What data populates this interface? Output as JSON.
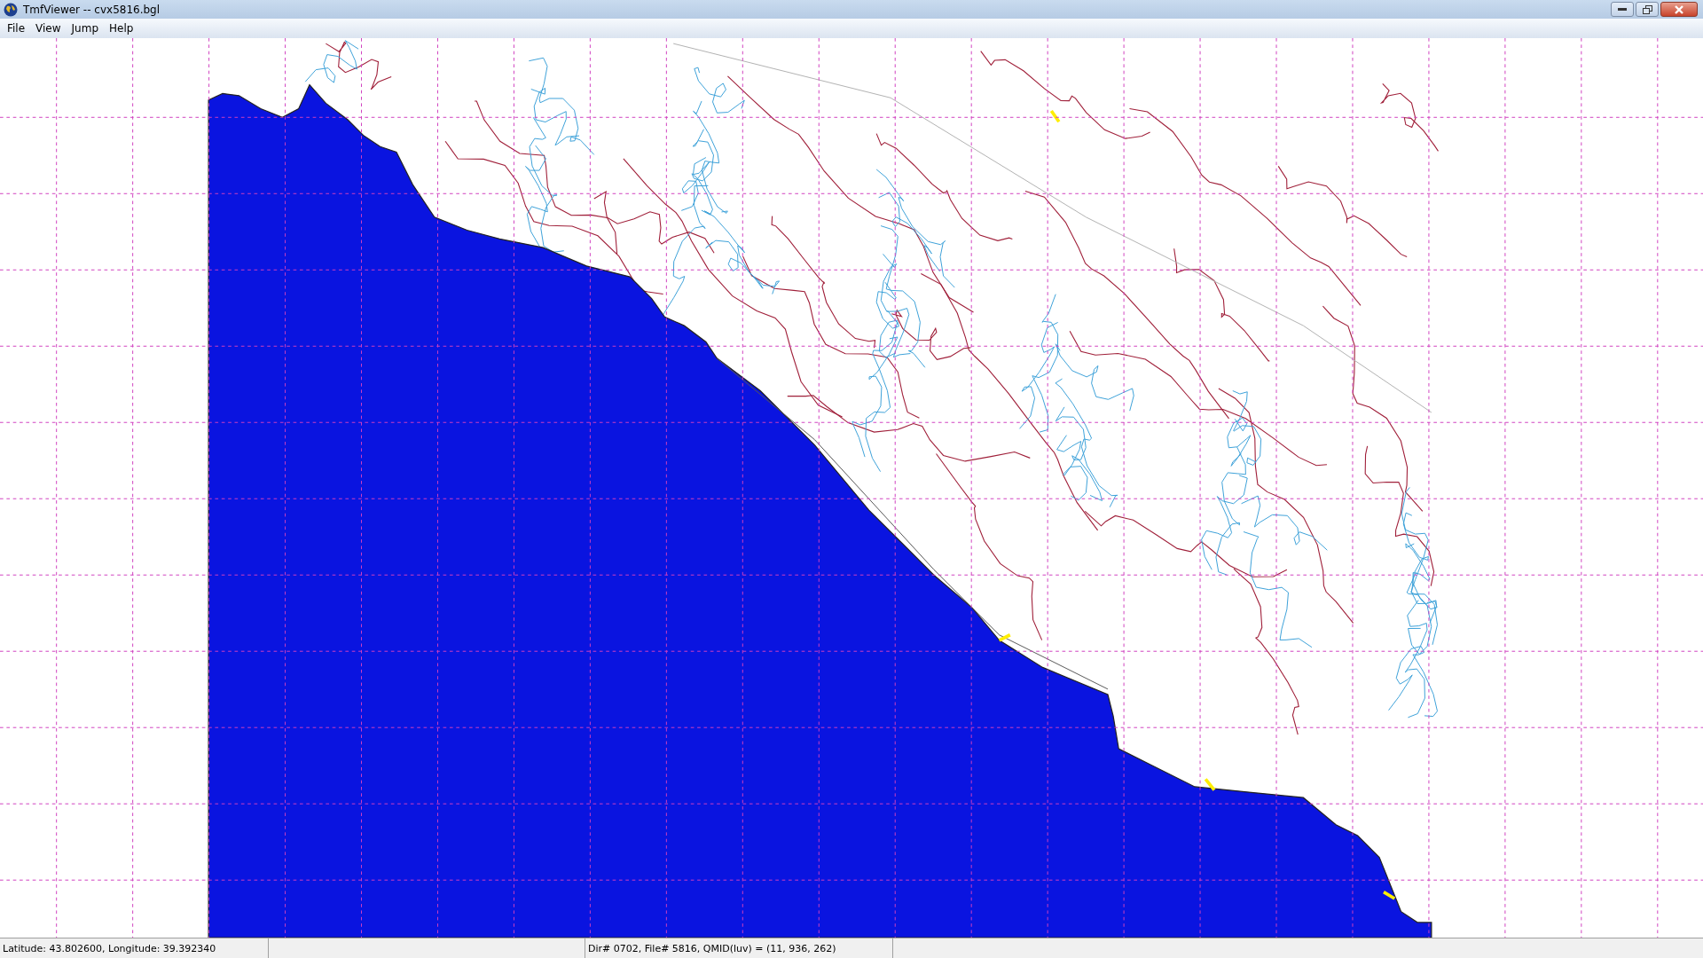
{
  "window": {
    "title": "TmfViewer -- cvx5816.bgl"
  },
  "menu": [
    "File",
    "View",
    "Jump",
    "Help"
  ],
  "status_bar": {
    "position": "Latitude: 43.802600, Longitude: 39.392340",
    "middle": "Dir# 0702, File# 5816, QMID(luv) = (11, 936, 262)"
  }
}
